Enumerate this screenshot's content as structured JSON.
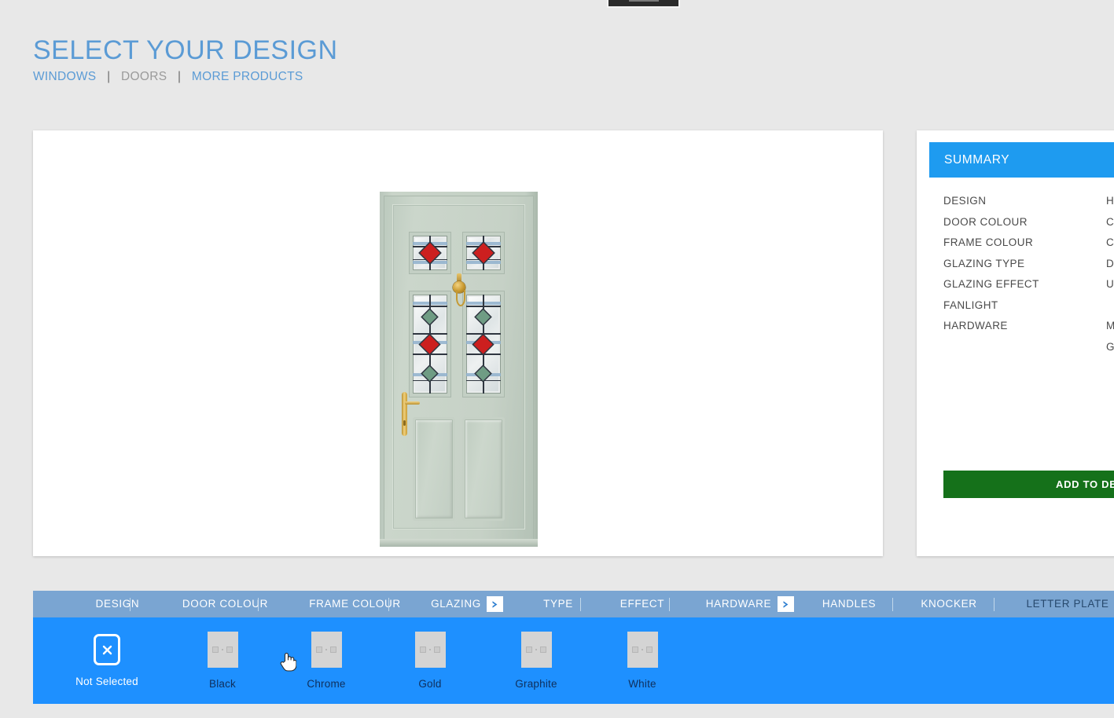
{
  "header": {
    "title": "SELECT YOUR DESIGN",
    "breadcrumb": [
      {
        "label": "WINDOWS",
        "active": true
      },
      {
        "label": "DOORS",
        "active": false
      },
      {
        "label": "MORE PRODUCTS",
        "active": true
      }
    ],
    "separator": "|"
  },
  "preview": {
    "product": "composite front door",
    "door_colour_hex": "#c6d1c6",
    "glass_red_hex": "#cc1f1f",
    "glass_green_hex": "#6f9c84",
    "hardware_gold_hex": "#c99c33"
  },
  "summary": {
    "heading": "SUMMARY",
    "rows": [
      {
        "label": "DESIGN",
        "value": "Ha"
      },
      {
        "label": "DOOR COLOUR",
        "value": "Ch"
      },
      {
        "label": "FRAME COLOUR",
        "value": "Ch"
      },
      {
        "label": "GLAZING TYPE",
        "value": "Do"
      },
      {
        "label": "GLAZING EFFECT",
        "value": "Un"
      },
      {
        "label": "FANLIGHT",
        "value": ""
      },
      {
        "label": "HARDWARE",
        "value": "Mo"
      },
      {
        "label": "",
        "value": "Go"
      }
    ],
    "add_button": "ADD TO DESIGN",
    "accent_hex": "#1e9bf0",
    "button_hex": "#15711a"
  },
  "tabs": {
    "items": [
      {
        "label": "DESIGN",
        "active": false
      },
      {
        "label": "DOOR COLOUR",
        "active": false
      },
      {
        "label": "FRAME COLOUR",
        "active": false
      },
      {
        "label": "GLAZING",
        "active": false
      },
      {
        "label": "TYPE",
        "active": false
      },
      {
        "label": "EFFECT",
        "active": false
      },
      {
        "label": "HARDWARE",
        "active": false
      },
      {
        "label": "HANDLES",
        "active": false
      },
      {
        "label": "KNOCKER",
        "active": false
      },
      {
        "label": "LETTER PLATE",
        "active": true
      }
    ],
    "next_button": ">",
    "bar_hex": "#7aa5d2"
  },
  "swatches": {
    "items": [
      {
        "label": "Not Selected",
        "kind": "none"
      },
      {
        "label": "Black",
        "kind": "image"
      },
      {
        "label": "Chrome",
        "kind": "image"
      },
      {
        "label": "Gold",
        "kind": "image"
      },
      {
        "label": "Graphite",
        "kind": "image"
      },
      {
        "label": "White",
        "kind": "image"
      }
    ],
    "strip_hex": "#1e90ff"
  }
}
